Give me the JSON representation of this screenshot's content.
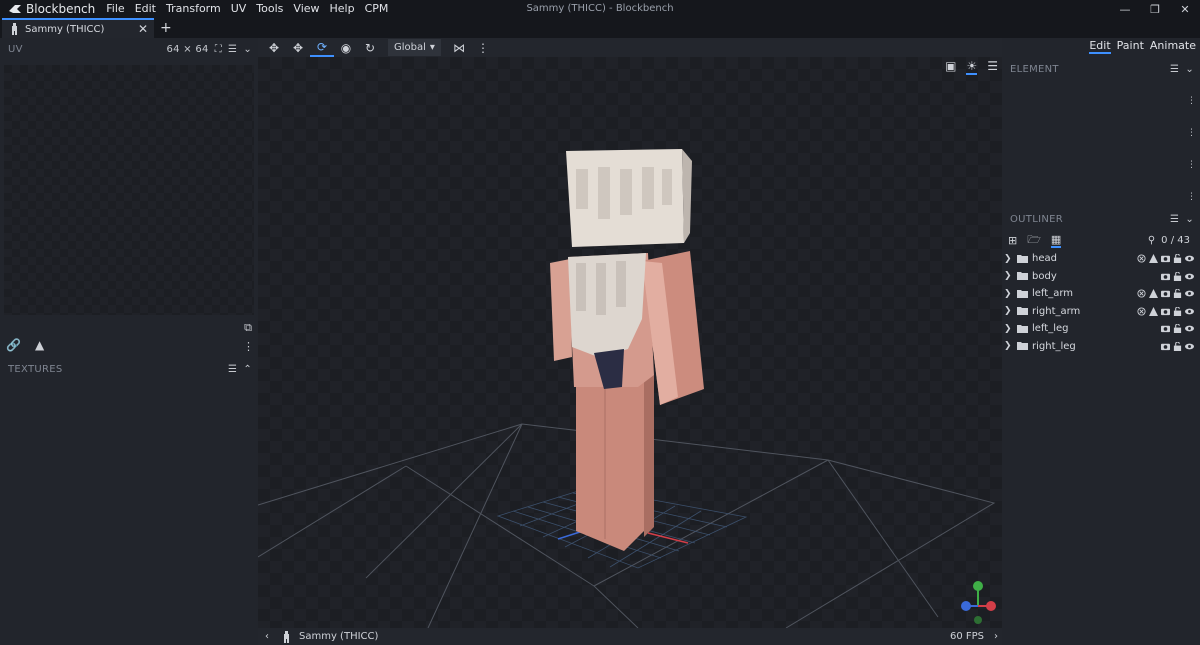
{
  "app": {
    "brand": "Blockbench",
    "menu": [
      "File",
      "Edit",
      "Transform",
      "UV",
      "Tools",
      "View",
      "Help",
      "CPM"
    ],
    "window_title": "Sammy (THICC) - Blockbench",
    "window_controls": [
      "minimize-icon",
      "restore-icon",
      "close-icon"
    ]
  },
  "tabs": {
    "items": [
      {
        "label": "Sammy (THICC)"
      }
    ],
    "add_label": "+"
  },
  "uv_panel": {
    "title": "UV",
    "size_label": "64 ⨯ 64"
  },
  "textures_panel": {
    "title": "TEXTURES"
  },
  "viewport": {
    "transform_space": "Global",
    "model_name": "Sammy (THICC)",
    "fps": "60 FPS"
  },
  "modes": {
    "items": [
      "Edit",
      "Paint",
      "Animate"
    ],
    "active": "Edit"
  },
  "element_panel": {
    "title": "ELEMENT"
  },
  "outliner": {
    "title": "OUTLINER",
    "count": "0 / 43",
    "groups": [
      {
        "name": "head",
        "has_export_toggle": true
      },
      {
        "name": "body",
        "has_export_toggle": false
      },
      {
        "name": "left_arm",
        "has_export_toggle": true
      },
      {
        "name": "right_arm",
        "has_export_toggle": true
      },
      {
        "name": "left_leg",
        "has_export_toggle": false
      },
      {
        "name": "right_leg",
        "has_export_toggle": false
      }
    ]
  },
  "colors": {
    "accent": "#3e90ff",
    "panel": "#22252c",
    "background": "#1b1d23",
    "skin": "#d49a8d",
    "hair": "#d8d2cc"
  }
}
